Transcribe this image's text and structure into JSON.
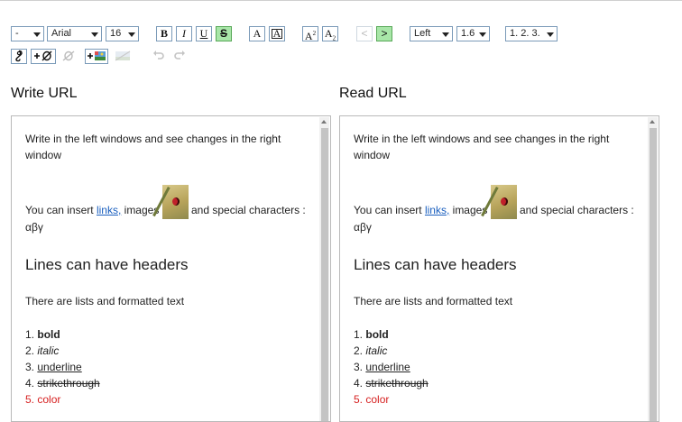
{
  "toolbar": {
    "block_format": "-",
    "font_family": "Arial",
    "font_size": "16",
    "bold": "B",
    "italic": "I",
    "underline": "U",
    "strike": "S",
    "text_color": "A",
    "bg_color": "A",
    "superscript": "A",
    "subscript": "A",
    "align_left_prev": "<",
    "align_next": ">",
    "alignment": "Left",
    "line_height": "1.6",
    "list_style": "1. 2. 3.",
    "icons": [
      "link-icon",
      "add-link-icon",
      "unlink-icon",
      "insert-image-icon",
      "image-disabled-icon",
      "undo-icon",
      "redo-icon"
    ]
  },
  "panes": {
    "write_title": "Write URL",
    "read_title": "Read URL"
  },
  "doc": {
    "line1": "Write in the left windows and see changes in the right window",
    "insert_pre": "You can insert ",
    "link": "links",
    "comma": ",",
    "images": " images ",
    "special": " and special characters : αβγ",
    "header": "Lines can have headers",
    "lists": "There are lists and formatted text",
    "items": [
      {
        "n": "1.",
        "t": "bold"
      },
      {
        "n": "2.",
        "t": "italic"
      },
      {
        "n": "3.",
        "t": "underline"
      },
      {
        "n": "4.",
        "t": "strikethrough"
      },
      {
        "n": "5.",
        "t": "color"
      }
    ]
  }
}
